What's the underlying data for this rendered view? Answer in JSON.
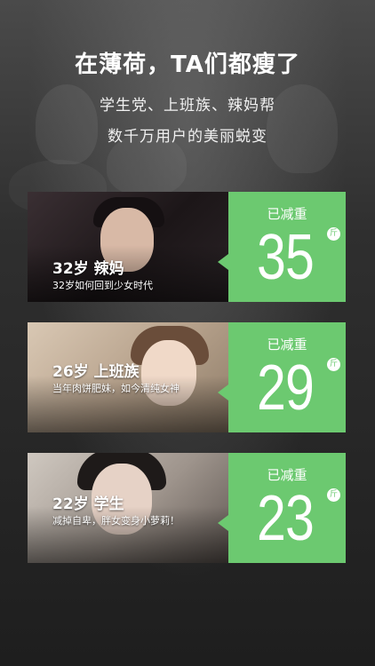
{
  "header": {
    "headline": "在薄荷，TA们都瘦了",
    "subline1": "学生党、上班族、辣妈帮",
    "subline2": "数千万用户的美丽蜕变"
  },
  "cards": [
    {
      "title": "32岁  辣妈",
      "description": "32岁如何回到少女时代",
      "panel_label": "已减重",
      "weight_lost": "35",
      "unit": "斤"
    },
    {
      "title": "26岁  上班族",
      "description": "当年肉饼肥妹，如今清纯女神",
      "panel_label": "已减重",
      "weight_lost": "29",
      "unit": "斤"
    },
    {
      "title": "22岁  学生",
      "description": "减掉自卑，胖女变身小萝莉！",
      "panel_label": "已减重",
      "weight_lost": "23",
      "unit": "斤"
    }
  ],
  "colors": {
    "accent_green": "#6cc970",
    "background": "#2b2b2b",
    "text": "#ffffff"
  }
}
